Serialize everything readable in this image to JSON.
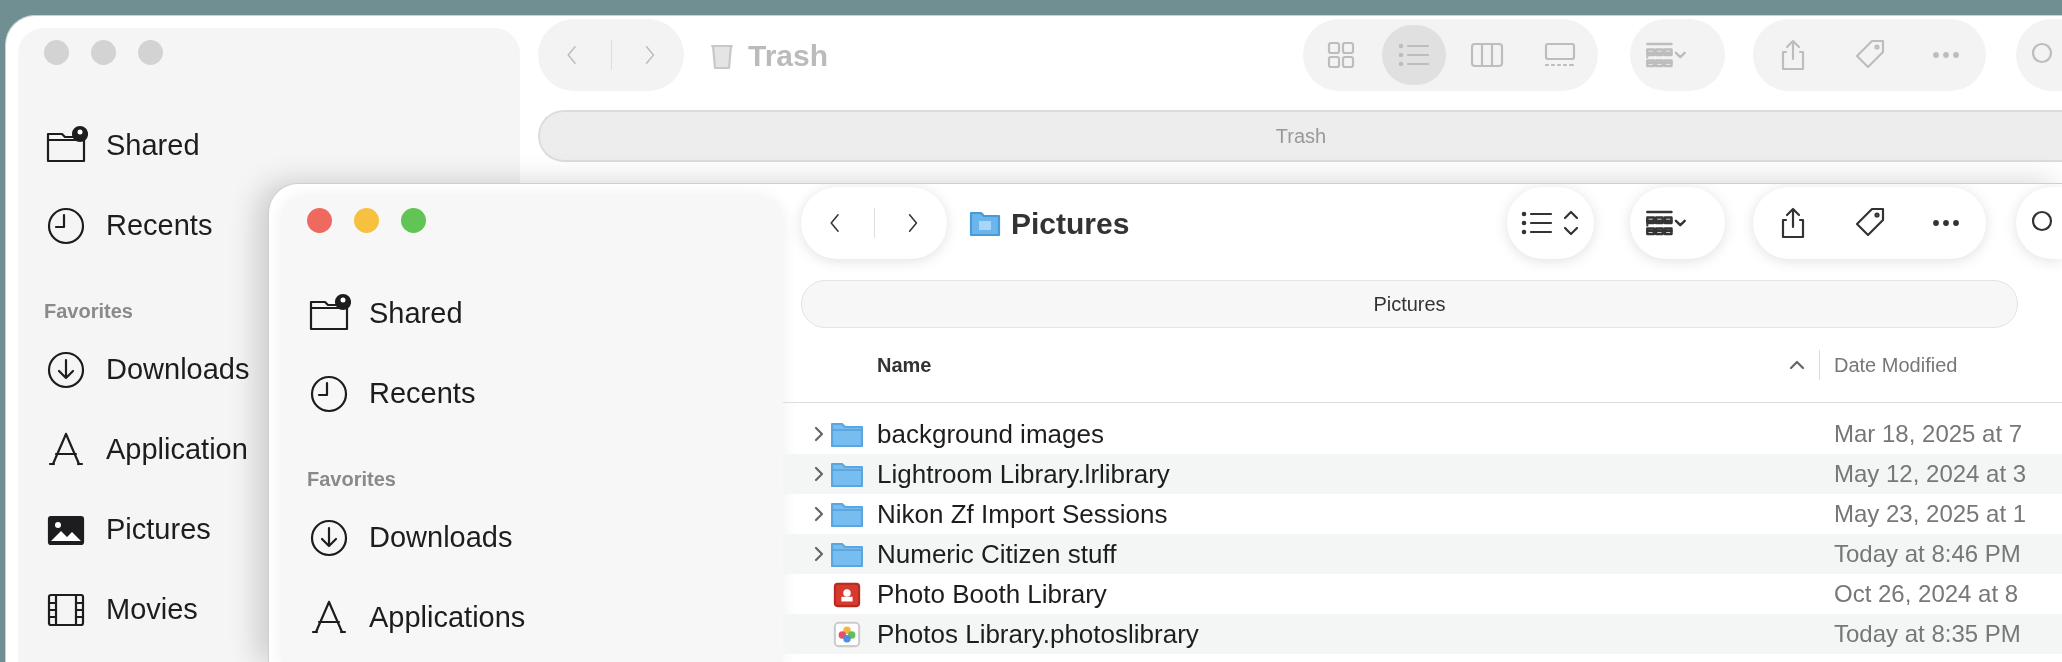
{
  "windows": [
    {
      "active": false,
      "kind": "trash",
      "title": "Trash",
      "path_bar": "Trash",
      "sidebar": {
        "items": [
          {
            "kind": "shared",
            "label": "Shared"
          },
          {
            "kind": "recents",
            "label": "Recents"
          }
        ],
        "sections": [
          {
            "heading": "Favorites",
            "items": [
              {
                "kind": "downloads",
                "label": "Downloads"
              },
              {
                "kind": "applications",
                "label": "Application"
              },
              {
                "kind": "pictures",
                "label": "Pictures"
              },
              {
                "kind": "movies",
                "label": "Movies"
              }
            ]
          }
        ]
      },
      "view_modes": [
        {
          "kind": "icons",
          "selected": false
        },
        {
          "kind": "list",
          "selected": true
        },
        {
          "kind": "columns",
          "selected": false
        },
        {
          "kind": "gallery",
          "selected": false
        }
      ]
    },
    {
      "active": true,
      "kind": "folder",
      "title": "Pictures",
      "path_bar": "Pictures",
      "sidebar": {
        "items": [
          {
            "kind": "shared",
            "label": "Shared"
          },
          {
            "kind": "recents",
            "label": "Recents"
          }
        ],
        "sections": [
          {
            "heading": "Favorites",
            "items": [
              {
                "kind": "downloads",
                "label": "Downloads"
              },
              {
                "kind": "applications",
                "label": "Applications"
              }
            ]
          }
        ]
      },
      "columns": [
        {
          "label": "Name",
          "sorted": true
        },
        {
          "label": "Date Modified",
          "sorted": false
        }
      ],
      "rows": [
        {
          "kind": "folder",
          "expandable": true,
          "name": "background images",
          "date": "Mar 18, 2025 at 7"
        },
        {
          "kind": "folder",
          "expandable": true,
          "name": "Lightroom Library.lrlibrary",
          "date": "May 12, 2024 at 3"
        },
        {
          "kind": "folder",
          "expandable": true,
          "name": "Nikon Zf Import Sessions",
          "date": "May 23, 2025 at 1"
        },
        {
          "kind": "folder",
          "expandable": true,
          "name": "Numeric Citizen stuff",
          "date": "Today at 8:46 PM"
        },
        {
          "kind": "booth",
          "expandable": false,
          "name": "Photo Booth Library",
          "date": "Oct 26, 2024 at 8"
        },
        {
          "kind": "photos",
          "expandable": false,
          "name": "Photos Library.photoslibrary",
          "date": "Today at 8:35 PM"
        }
      ]
    }
  ]
}
